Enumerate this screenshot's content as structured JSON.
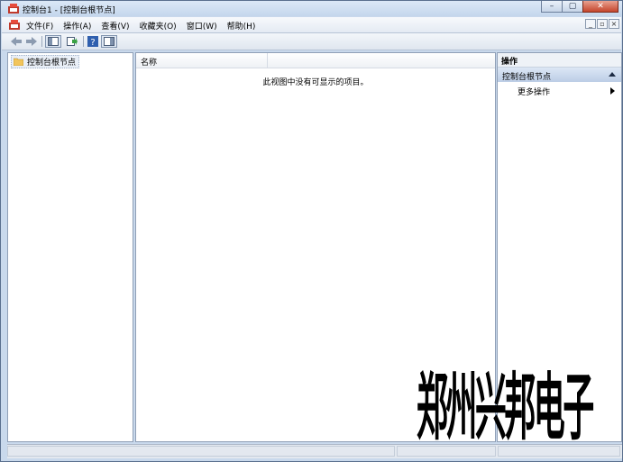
{
  "window": {
    "title": "控制台1 - [控制台根节点]",
    "controls": {
      "minimize": "–",
      "maximize": "▢",
      "close": "✕"
    }
  },
  "menubar": {
    "items": [
      "文件(F)",
      "操作(A)",
      "查看(V)",
      "收藏夹(O)",
      "窗口(W)",
      "帮助(H)"
    ],
    "mdi_controls": {
      "minimize": "_",
      "restore": "▫",
      "close": "×"
    }
  },
  "toolbar": {
    "buttons": [
      "back-arrow-icon",
      "forward-arrow-icon",
      "show-hide-tree-icon",
      "export-list-icon",
      "help-icon",
      "show-hide-action-pane-icon"
    ]
  },
  "tree": {
    "root_label": "控制台根节点"
  },
  "list": {
    "columns": [
      "名称"
    ],
    "empty_message": "此视图中没有可显示的项目。"
  },
  "actions": {
    "header": "操作",
    "section_title": "控制台根节点",
    "items": [
      "更多操作"
    ]
  },
  "watermark": {
    "text": "郑州兴邦电子"
  },
  "colors": {
    "accent": "#bccde6",
    "titlebar": "#c4d6ec",
    "close_button": "#c5452c"
  }
}
